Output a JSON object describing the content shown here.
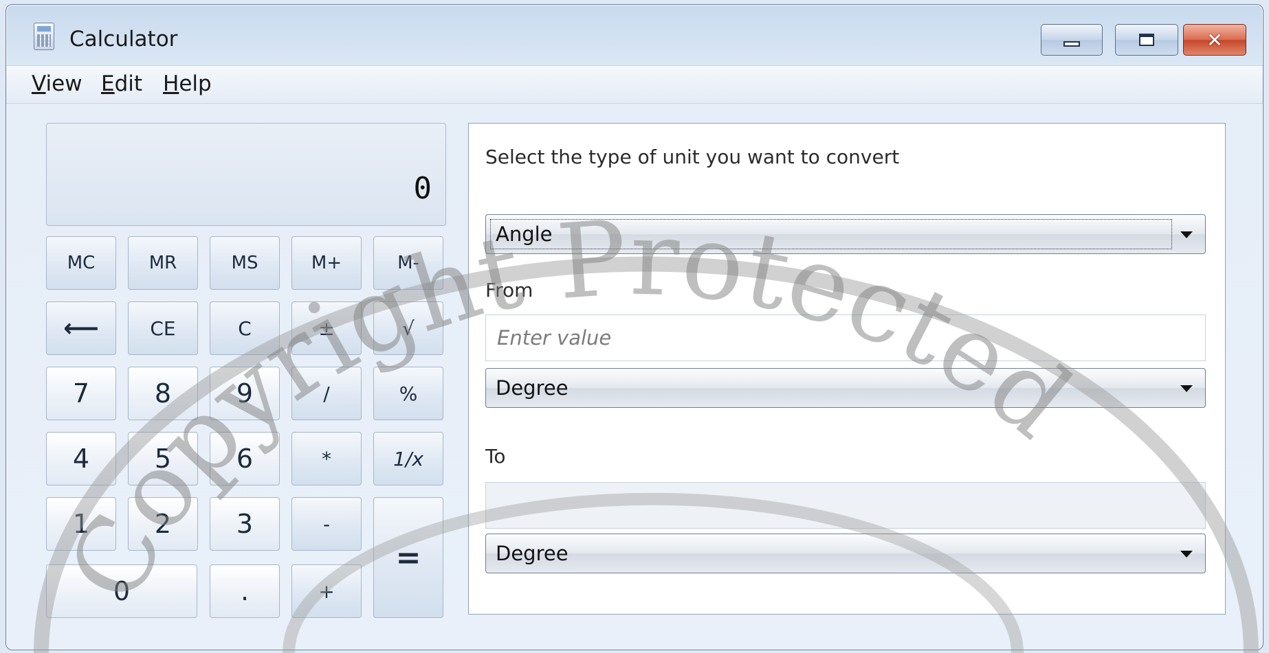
{
  "window": {
    "title": "Calculator",
    "icon": "calculator-icon"
  },
  "caption": {
    "minimize": "minimize-icon",
    "maximize": "maximize-icon",
    "close": "✕"
  },
  "menu": {
    "items": [
      {
        "letter": "V",
        "rest": "iew"
      },
      {
        "letter": "E",
        "rest": "dit"
      },
      {
        "letter": "H",
        "rest": "elp"
      }
    ]
  },
  "display": {
    "value": "0"
  },
  "keypad": {
    "memory": [
      "MC",
      "MR",
      "MS",
      "M+",
      "M-"
    ],
    "row2": [
      "⟵",
      "CE",
      "C",
      "±",
      "√"
    ],
    "row3": [
      "7",
      "8",
      "9",
      "/",
      "%"
    ],
    "row4": [
      "4",
      "5",
      "6",
      "*",
      "1/x"
    ],
    "row5": [
      "1",
      "2",
      "3",
      "-"
    ],
    "row6": [
      "0",
      ".",
      "+"
    ],
    "equals": "="
  },
  "converter": {
    "prompt": "Select the type of unit you want to convert",
    "type_value": "Angle",
    "from_label": "From",
    "from_placeholder": "Enter value",
    "from_unit": "Degree",
    "to_label": "To",
    "to_value": "",
    "to_unit": "Degree"
  },
  "watermark": {
    "text": "Copyright Protected"
  },
  "colors": {
    "close_button": "#c7462a",
    "window_frame": "#6b7f98",
    "panel_bg": "#ffffff"
  }
}
